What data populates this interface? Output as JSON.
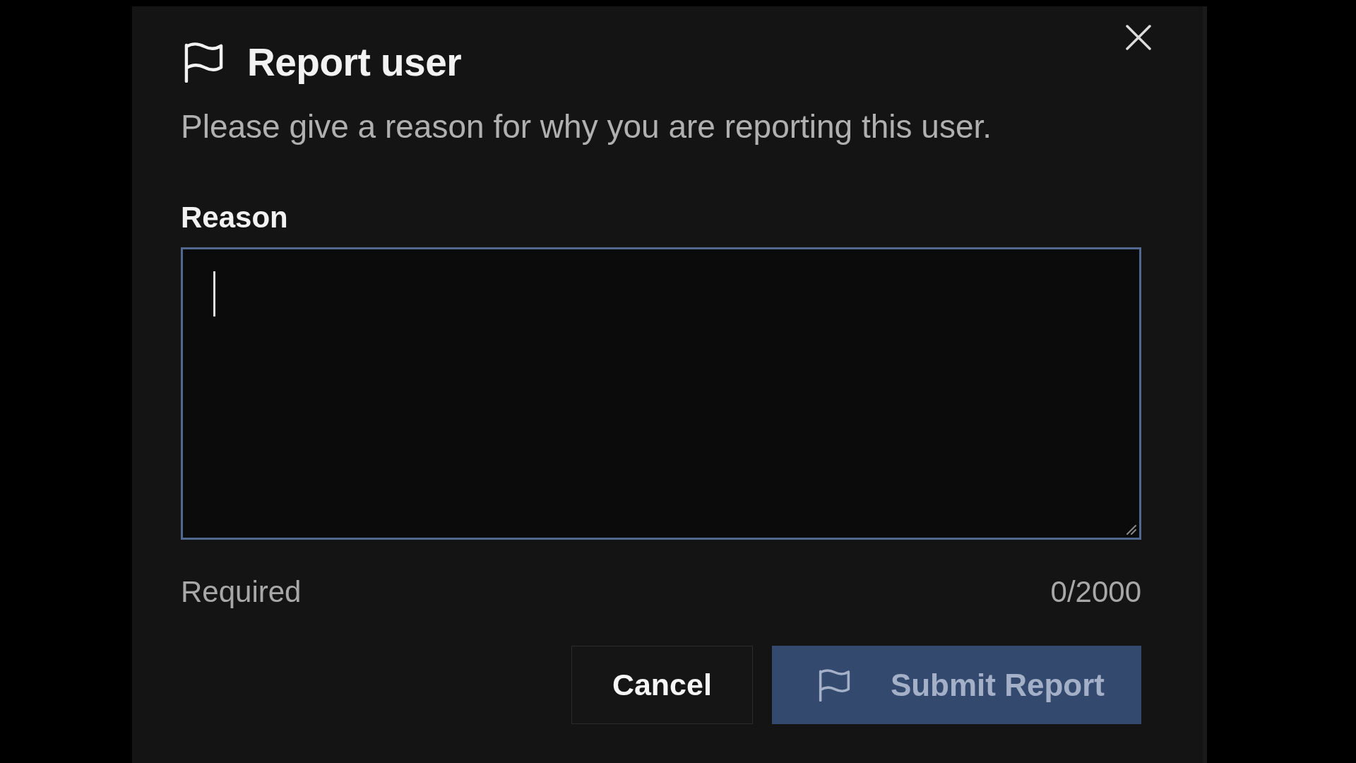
{
  "dialog": {
    "title": "Report user",
    "description": "Please give a reason for why you are reporting this user.",
    "reason_field": {
      "label": "Reason",
      "focused": true,
      "hint": "Required",
      "counter": "0/2000"
    },
    "buttons": [
      {
        "kind": "secondary",
        "label": "Cancel",
        "disabled": false
      },
      {
        "kind": "primary",
        "label": "Submit Report",
        "disabled": true
      }
    ]
  }
}
